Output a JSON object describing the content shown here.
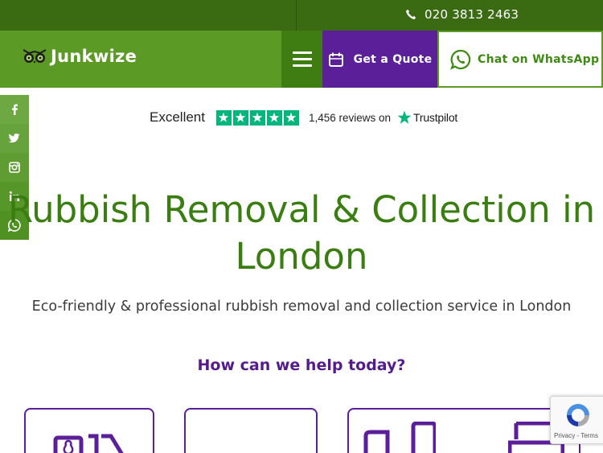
{
  "topbar": {
    "phone": "020 3813 2463",
    "phone_icon": "phone-icon"
  },
  "header": {
    "logo_text": "Junkwize",
    "logo_icon": "owl-logo-icon",
    "menu_icon": "hamburger-menu-icon",
    "quote_label": "Get a Quote",
    "quote_icon": "calendar-icon",
    "whatsapp_label": "Chat on WhatsApp",
    "whatsapp_icon": "whatsapp-icon"
  },
  "social": {
    "items": [
      {
        "name": "facebook",
        "glyph": "f"
      },
      {
        "name": "twitter",
        "glyph": "t"
      },
      {
        "name": "instagram",
        "glyph": "ig"
      },
      {
        "name": "linkedin",
        "glyph": "in"
      },
      {
        "name": "whatsapp",
        "glyph": "wa"
      }
    ]
  },
  "trustpilot": {
    "rating_word": "Excellent",
    "stars": 5,
    "reviews_text": "1,456 reviews on",
    "brand": "Trustpilot",
    "star_color": "#00b67a"
  },
  "hero": {
    "title_line1": "Rubbish Removal & Collection in",
    "title_line2": "London",
    "subtitle": "Eco-friendly & professional rubbish removal and collection service in London"
  },
  "help": {
    "heading": "How can we help today?"
  },
  "recaptcha": {
    "links": "Privacy - Terms"
  },
  "colors": {
    "topbar": "#3a6b13",
    "header": "#5a9a25",
    "menu": "#3f7d12",
    "quote": "#5c1f9a",
    "title_green": "#3a7d11",
    "heading_purple": "#551a8b"
  }
}
